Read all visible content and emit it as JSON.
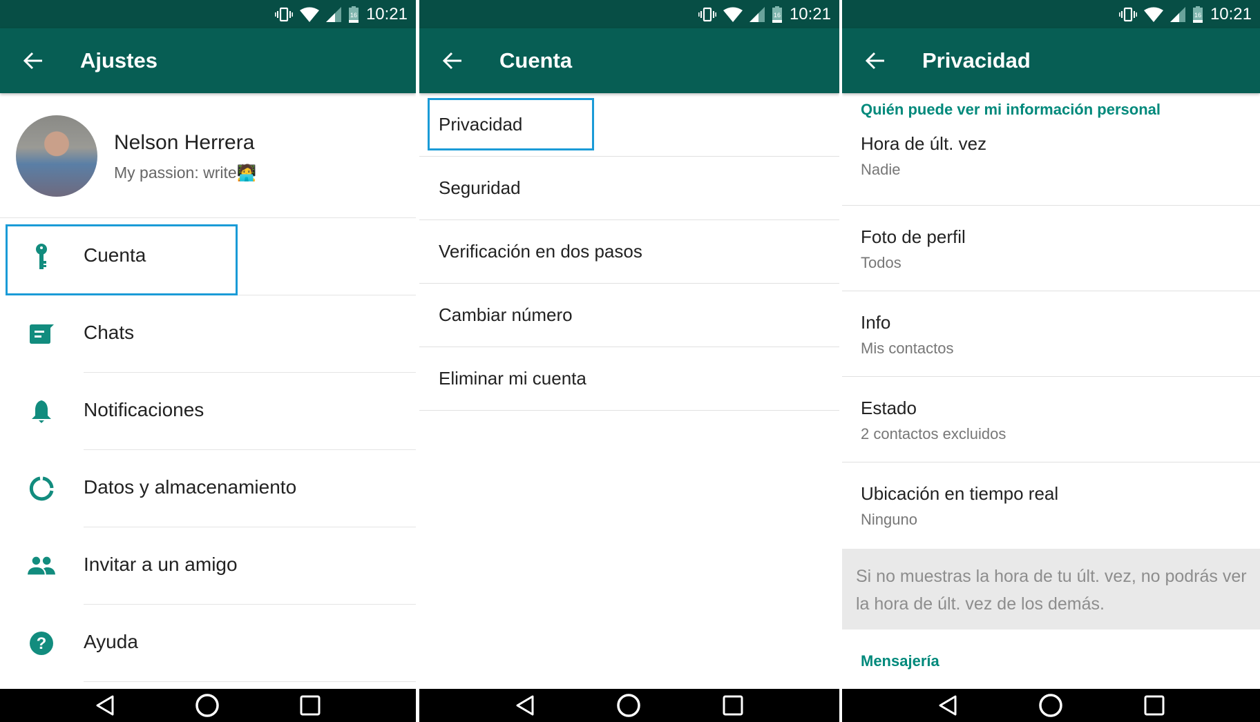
{
  "status_bar": {
    "time": "10:21",
    "battery_level": "16",
    "icons": [
      "vibrate-icon",
      "wifi-icon",
      "signal-icon",
      "battery-icon"
    ]
  },
  "screens": {
    "ajustes": {
      "title": "Ajustes",
      "profile": {
        "name": "Nelson Herrera",
        "status": "My passion: write",
        "status_emoji": "🧑‍💻"
      },
      "items": [
        {
          "label": "Cuenta",
          "icon": "key-icon"
        },
        {
          "label": "Chats",
          "icon": "chat-icon"
        },
        {
          "label": "Notificaciones",
          "icon": "bell-icon"
        },
        {
          "label": "Datos y almacenamiento",
          "icon": "data-usage-icon"
        },
        {
          "label": "Invitar a un amigo",
          "icon": "people-icon"
        },
        {
          "label": "Ayuda",
          "icon": "help-icon"
        }
      ]
    },
    "cuenta": {
      "title": "Cuenta",
      "items": [
        {
          "label": "Privacidad"
        },
        {
          "label": "Seguridad"
        },
        {
          "label": "Verificación en dos pasos"
        },
        {
          "label": "Cambiar número"
        },
        {
          "label": "Eliminar mi cuenta"
        }
      ]
    },
    "privacidad": {
      "title": "Privacidad",
      "section_header": "Quién puede ver mi información personal",
      "items": [
        {
          "title": "Hora de últ. vez",
          "value": "Nadie"
        },
        {
          "title": "Foto de perfil",
          "value": "Todos"
        },
        {
          "title": "Info",
          "value": "Mis contactos"
        },
        {
          "title": "Estado",
          "value": "2 contactos excluidos"
        },
        {
          "title": "Ubicación en tiempo real",
          "value": "Ninguno"
        }
      ],
      "notice": "Si no muestras la hora de tu últ. vez, no podrás ver la hora de últ. vez de los demás.",
      "section_header_2": "Mensajería"
    }
  },
  "colors": {
    "toolbar": "#075e54",
    "status_bar": "#074e45",
    "accent": "#00897b",
    "highlight": "#1a9bd7"
  }
}
